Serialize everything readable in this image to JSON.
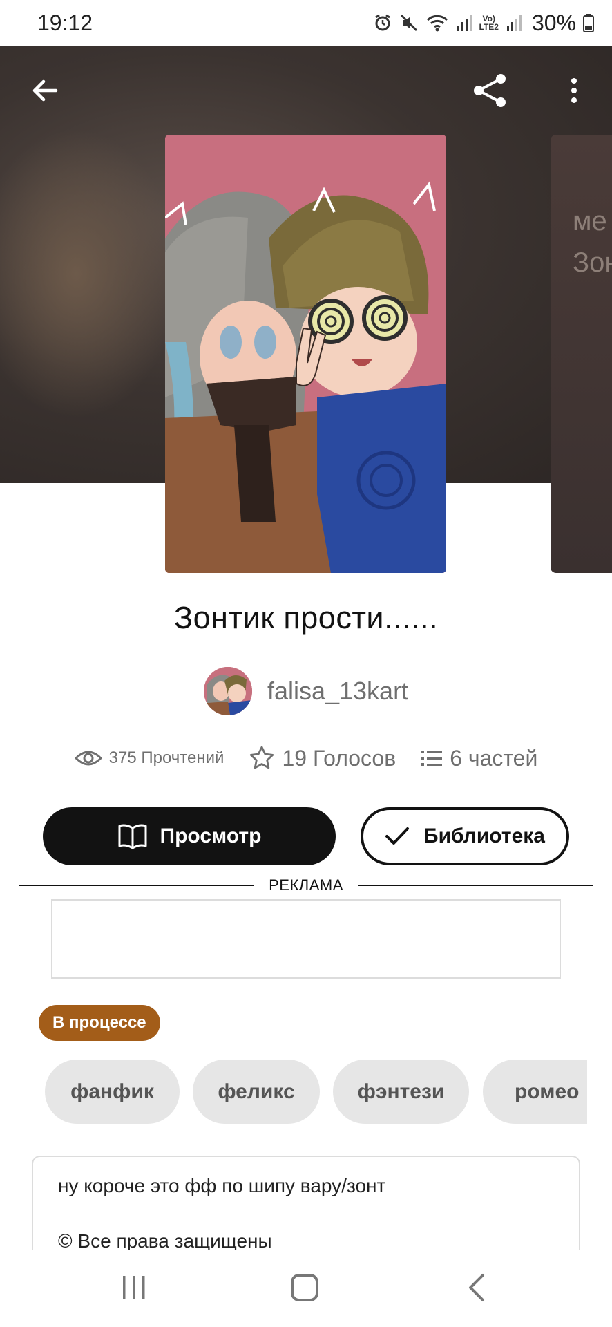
{
  "status_bar": {
    "time": "19:12",
    "battery": "30%",
    "network": "LTE2",
    "icons": [
      "alarm-icon",
      "mute-icon",
      "wifi-icon",
      "signal-icon",
      "volte-icon",
      "signal-icon",
      "battery-icon"
    ]
  },
  "top_nav": {
    "icons": [
      "back-arrow-icon",
      "share-icon",
      "more-vertical-icon"
    ]
  },
  "story": {
    "title": "Зонтик прости......",
    "author": "falisa_13kart",
    "next_cover_text": "ме\nЗон",
    "stats": {
      "reads": "375 Прочтений",
      "votes": "19 Голосов",
      "parts": "6 частей"
    }
  },
  "actions": {
    "read_label": "Просмотр",
    "library_label": "Библиотека"
  },
  "ad": {
    "label": "РЕКЛАМА"
  },
  "status_badge": "В процессе",
  "tags": [
    "фанфик",
    "феликс",
    "фэнтези",
    "ромео"
  ],
  "description": {
    "line1": "ну короче это фф по шипу вару/зонт",
    "line2": "© Все права защищены"
  },
  "colors": {
    "primary_dark": "#121212",
    "badge": "#a35d19",
    "tag_bg": "#e6e6e6",
    "muted_text": "#6f6f6f"
  }
}
